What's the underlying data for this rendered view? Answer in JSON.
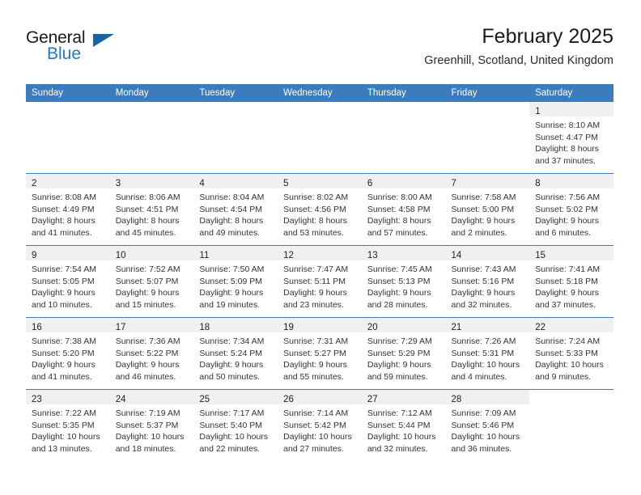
{
  "brand": {
    "name_part1": "General",
    "name_part2": "Blue",
    "triangle_color": "#1565a8",
    "accent_color": "#3a7cbe"
  },
  "header": {
    "month_title": "February 2025",
    "location": "Greenhill, Scotland, United Kingdom"
  },
  "weekday_headers": [
    "Sunday",
    "Monday",
    "Tuesday",
    "Wednesday",
    "Thursday",
    "Friday",
    "Saturday"
  ],
  "weeks": [
    [
      {
        "day": "",
        "sunrise": "",
        "sunset": "",
        "daylight1": "",
        "daylight2": ""
      },
      {
        "day": "",
        "sunrise": "",
        "sunset": "",
        "daylight1": "",
        "daylight2": ""
      },
      {
        "day": "",
        "sunrise": "",
        "sunset": "",
        "daylight1": "",
        "daylight2": ""
      },
      {
        "day": "",
        "sunrise": "",
        "sunset": "",
        "daylight1": "",
        "daylight2": ""
      },
      {
        "day": "",
        "sunrise": "",
        "sunset": "",
        "daylight1": "",
        "daylight2": ""
      },
      {
        "day": "",
        "sunrise": "",
        "sunset": "",
        "daylight1": "",
        "daylight2": ""
      },
      {
        "day": "1",
        "sunrise": "Sunrise: 8:10 AM",
        "sunset": "Sunset: 4:47 PM",
        "daylight1": "Daylight: 8 hours",
        "daylight2": "and 37 minutes."
      }
    ],
    [
      {
        "day": "2",
        "sunrise": "Sunrise: 8:08 AM",
        "sunset": "Sunset: 4:49 PM",
        "daylight1": "Daylight: 8 hours",
        "daylight2": "and 41 minutes."
      },
      {
        "day": "3",
        "sunrise": "Sunrise: 8:06 AM",
        "sunset": "Sunset: 4:51 PM",
        "daylight1": "Daylight: 8 hours",
        "daylight2": "and 45 minutes."
      },
      {
        "day": "4",
        "sunrise": "Sunrise: 8:04 AM",
        "sunset": "Sunset: 4:54 PM",
        "daylight1": "Daylight: 8 hours",
        "daylight2": "and 49 minutes."
      },
      {
        "day": "5",
        "sunrise": "Sunrise: 8:02 AM",
        "sunset": "Sunset: 4:56 PM",
        "daylight1": "Daylight: 8 hours",
        "daylight2": "and 53 minutes."
      },
      {
        "day": "6",
        "sunrise": "Sunrise: 8:00 AM",
        "sunset": "Sunset: 4:58 PM",
        "daylight1": "Daylight: 8 hours",
        "daylight2": "and 57 minutes."
      },
      {
        "day": "7",
        "sunrise": "Sunrise: 7:58 AM",
        "sunset": "Sunset: 5:00 PM",
        "daylight1": "Daylight: 9 hours",
        "daylight2": "and 2 minutes."
      },
      {
        "day": "8",
        "sunrise": "Sunrise: 7:56 AM",
        "sunset": "Sunset: 5:02 PM",
        "daylight1": "Daylight: 9 hours",
        "daylight2": "and 6 minutes."
      }
    ],
    [
      {
        "day": "9",
        "sunrise": "Sunrise: 7:54 AM",
        "sunset": "Sunset: 5:05 PM",
        "daylight1": "Daylight: 9 hours",
        "daylight2": "and 10 minutes."
      },
      {
        "day": "10",
        "sunrise": "Sunrise: 7:52 AM",
        "sunset": "Sunset: 5:07 PM",
        "daylight1": "Daylight: 9 hours",
        "daylight2": "and 15 minutes."
      },
      {
        "day": "11",
        "sunrise": "Sunrise: 7:50 AM",
        "sunset": "Sunset: 5:09 PM",
        "daylight1": "Daylight: 9 hours",
        "daylight2": "and 19 minutes."
      },
      {
        "day": "12",
        "sunrise": "Sunrise: 7:47 AM",
        "sunset": "Sunset: 5:11 PM",
        "daylight1": "Daylight: 9 hours",
        "daylight2": "and 23 minutes."
      },
      {
        "day": "13",
        "sunrise": "Sunrise: 7:45 AM",
        "sunset": "Sunset: 5:13 PM",
        "daylight1": "Daylight: 9 hours",
        "daylight2": "and 28 minutes."
      },
      {
        "day": "14",
        "sunrise": "Sunrise: 7:43 AM",
        "sunset": "Sunset: 5:16 PM",
        "daylight1": "Daylight: 9 hours",
        "daylight2": "and 32 minutes."
      },
      {
        "day": "15",
        "sunrise": "Sunrise: 7:41 AM",
        "sunset": "Sunset: 5:18 PM",
        "daylight1": "Daylight: 9 hours",
        "daylight2": "and 37 minutes."
      }
    ],
    [
      {
        "day": "16",
        "sunrise": "Sunrise: 7:38 AM",
        "sunset": "Sunset: 5:20 PM",
        "daylight1": "Daylight: 9 hours",
        "daylight2": "and 41 minutes."
      },
      {
        "day": "17",
        "sunrise": "Sunrise: 7:36 AM",
        "sunset": "Sunset: 5:22 PM",
        "daylight1": "Daylight: 9 hours",
        "daylight2": "and 46 minutes."
      },
      {
        "day": "18",
        "sunrise": "Sunrise: 7:34 AM",
        "sunset": "Sunset: 5:24 PM",
        "daylight1": "Daylight: 9 hours",
        "daylight2": "and 50 minutes."
      },
      {
        "day": "19",
        "sunrise": "Sunrise: 7:31 AM",
        "sunset": "Sunset: 5:27 PM",
        "daylight1": "Daylight: 9 hours",
        "daylight2": "and 55 minutes."
      },
      {
        "day": "20",
        "sunrise": "Sunrise: 7:29 AM",
        "sunset": "Sunset: 5:29 PM",
        "daylight1": "Daylight: 9 hours",
        "daylight2": "and 59 minutes."
      },
      {
        "day": "21",
        "sunrise": "Sunrise: 7:26 AM",
        "sunset": "Sunset: 5:31 PM",
        "daylight1": "Daylight: 10 hours",
        "daylight2": "and 4 minutes."
      },
      {
        "day": "22",
        "sunrise": "Sunrise: 7:24 AM",
        "sunset": "Sunset: 5:33 PM",
        "daylight1": "Daylight: 10 hours",
        "daylight2": "and 9 minutes."
      }
    ],
    [
      {
        "day": "23",
        "sunrise": "Sunrise: 7:22 AM",
        "sunset": "Sunset: 5:35 PM",
        "daylight1": "Daylight: 10 hours",
        "daylight2": "and 13 minutes."
      },
      {
        "day": "24",
        "sunrise": "Sunrise: 7:19 AM",
        "sunset": "Sunset: 5:37 PM",
        "daylight1": "Daylight: 10 hours",
        "daylight2": "and 18 minutes."
      },
      {
        "day": "25",
        "sunrise": "Sunrise: 7:17 AM",
        "sunset": "Sunset: 5:40 PM",
        "daylight1": "Daylight: 10 hours",
        "daylight2": "and 22 minutes."
      },
      {
        "day": "26",
        "sunrise": "Sunrise: 7:14 AM",
        "sunset": "Sunset: 5:42 PM",
        "daylight1": "Daylight: 10 hours",
        "daylight2": "and 27 minutes."
      },
      {
        "day": "27",
        "sunrise": "Sunrise: 7:12 AM",
        "sunset": "Sunset: 5:44 PM",
        "daylight1": "Daylight: 10 hours",
        "daylight2": "and 32 minutes."
      },
      {
        "day": "28",
        "sunrise": "Sunrise: 7:09 AM",
        "sunset": "Sunset: 5:46 PM",
        "daylight1": "Daylight: 10 hours",
        "daylight2": "and 36 minutes."
      },
      {
        "day": "",
        "sunrise": "",
        "sunset": "",
        "daylight1": "",
        "daylight2": ""
      }
    ]
  ]
}
